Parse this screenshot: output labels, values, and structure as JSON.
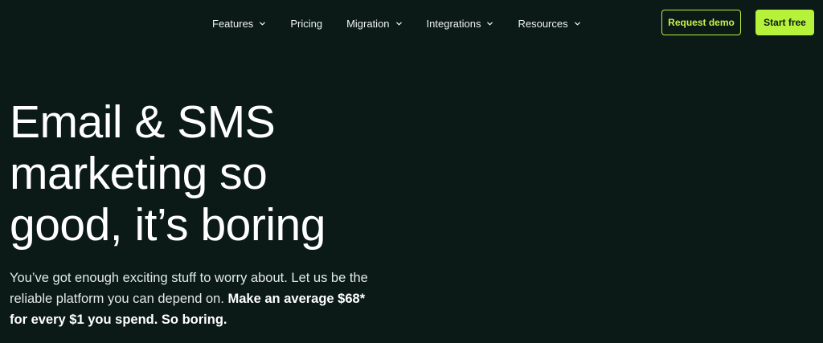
{
  "nav": {
    "items": [
      {
        "label": "Features",
        "has_dropdown": true
      },
      {
        "label": "Pricing",
        "has_dropdown": false
      },
      {
        "label": "Migration",
        "has_dropdown": true
      },
      {
        "label": "Integrations",
        "has_dropdown": true
      },
      {
        "label": "Resources",
        "has_dropdown": true
      }
    ],
    "icons": {
      "dropdown": "chevron-down-icon"
    }
  },
  "actions": {
    "request_demo": "Request demo",
    "start_free": "Start free"
  },
  "hero": {
    "title_lines": [
      "Email & SMS",
      "marketing so",
      "good, it’s boring"
    ],
    "subtitle_plain": "You’ve got enough exciting stuff to worry about. Let us be the reliable platform you can depend on. ",
    "subtitle_strong": "Make an average $68* for every $1 you spend. So boring."
  },
  "colors": {
    "background": "#0b1a17",
    "accent": "#b6f23a",
    "text": "#ffffff"
  }
}
